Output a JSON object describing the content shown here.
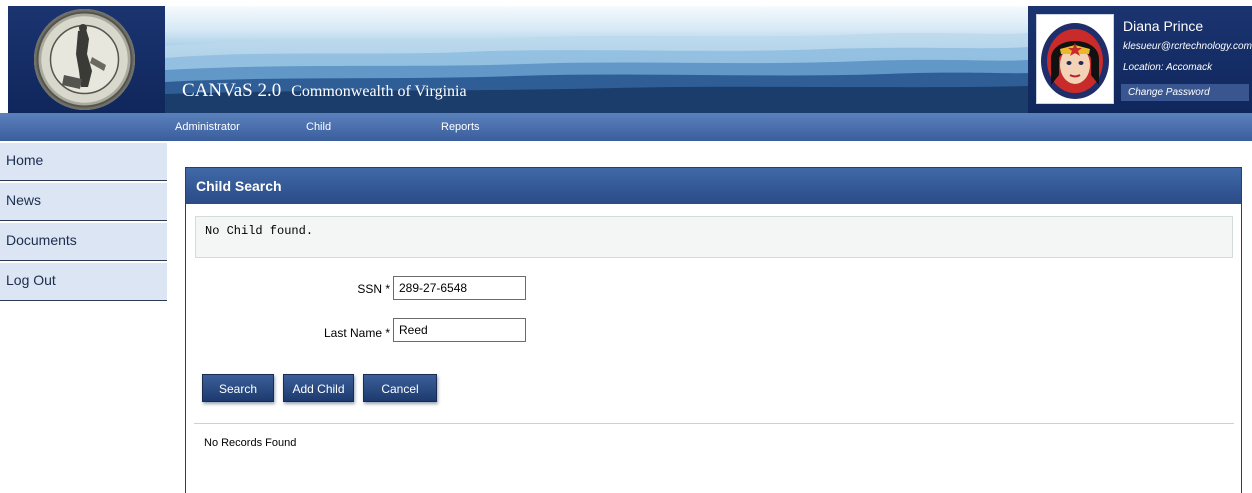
{
  "header": {
    "app_name": "CANVaS 2.0",
    "app_subtitle": "Commonwealth of Virginia",
    "seal_icon": "virginia-state-seal",
    "user": {
      "name": "Diana Prince",
      "email": "klesueur@rcrtechnology.com",
      "location": "Location: Accomack",
      "change_password_label": "Change Password",
      "avatar_icon": "wonder-woman-avatar"
    }
  },
  "nav": {
    "items": [
      {
        "label": "Administrator"
      },
      {
        "label": "Child"
      },
      {
        "label": "Reports"
      }
    ]
  },
  "sidebar": {
    "items": [
      {
        "label": "Home"
      },
      {
        "label": "News"
      },
      {
        "label": "Documents"
      },
      {
        "label": "Log Out"
      }
    ]
  },
  "main": {
    "panel_title": "Child Search",
    "message": "No Child found.",
    "fields": {
      "ssn": {
        "label": "SSN *",
        "value": "289-27-6548"
      },
      "last_name": {
        "label": "Last Name *",
        "value": "Reed"
      }
    },
    "buttons": {
      "search": "Search",
      "add_child": "Add Child",
      "cancel": "Cancel"
    },
    "results_text": "No Records Found"
  },
  "colors": {
    "header_navy": "#10275c",
    "nav_blue": "#4a6faf",
    "panel_header_blue": "#335893",
    "sidebar_bg": "#dbe5f3"
  }
}
